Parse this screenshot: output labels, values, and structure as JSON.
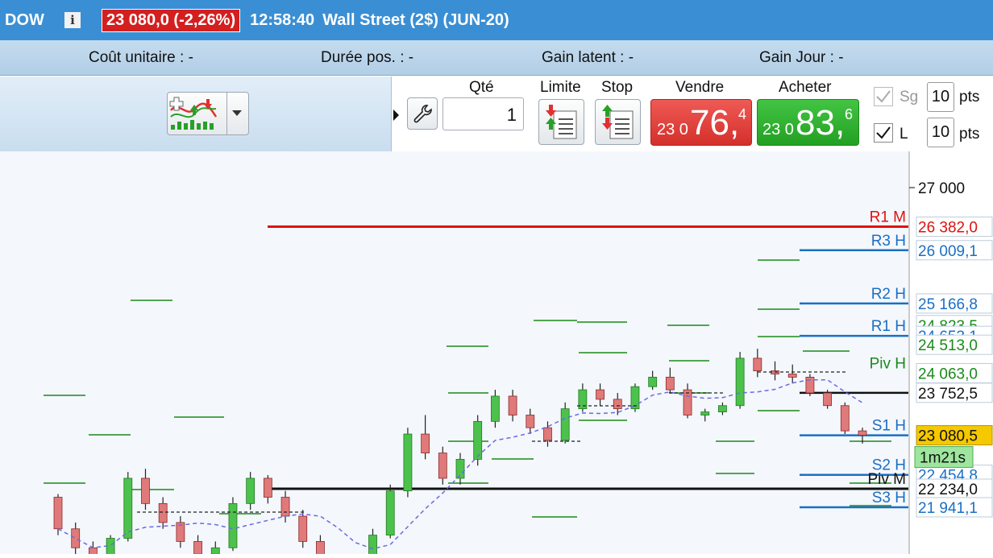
{
  "header": {
    "symbol": "DOW",
    "info_icon": "info-icon",
    "price_change": "23 080,0 (-2,26%)",
    "time": "12:58:40",
    "instrument": "Wall Street (2$) (JUN-20)",
    "accent": "#3a8fd4",
    "down_color": "#d41f1f"
  },
  "stats": {
    "unit_cost_label": "Coût unitaire :",
    "unit_cost_value": "-",
    "duration_label": "Durée pos. :",
    "duration_value": "-",
    "latent_gain_label": "Gain latent :",
    "latent_gain_value": "-",
    "day_gain_label": "Gain Jour :",
    "day_gain_value": "-"
  },
  "order": {
    "qty_label": "Qté",
    "qty_value": "1",
    "limit_label": "Limite",
    "stop_label": "Stop",
    "sell_label": "Vendre",
    "sell_prefix": "23 0",
    "sell_big": "76,",
    "sell_sup": "4",
    "buy_label": "Acheter",
    "buy_prefix": "23 0",
    "buy_big": "83,",
    "buy_sup": "6",
    "sg_label": "Sg",
    "sg_value": "10",
    "sg_unit": "pts",
    "l_label": "L",
    "l_value": "10",
    "l_unit": "pts"
  },
  "chart_data": {
    "type": "candlestick",
    "price_axis_ticks": [
      "27 000"
    ],
    "current_price": "23 080,5",
    "countdown": "1m21s",
    "levels": [
      {
        "label": "R1 M",
        "value": "26 382,0",
        "color": "#e01010"
      },
      {
        "label": "R3 H",
        "value": "26 009,1",
        "color": "#1a6fc4"
      },
      {
        "label": "R2 H",
        "value": "25 166,8",
        "color": "#1a6fc4"
      },
      {
        "label": "",
        "value": "24 823,5",
        "color": "#1a8a1a"
      },
      {
        "label": "R1 H",
        "value": "24 653,1",
        "color": "#1a6fc4"
      },
      {
        "label": "",
        "value": "24 513,0",
        "color": "#1a8a1a"
      },
      {
        "label": "Piv H",
        "value": "24 063,0",
        "color": "#1a8a1a"
      },
      {
        "label": "",
        "value": "23 752,5",
        "color": "#111111"
      },
      {
        "label": "S1 H",
        "value": "23 080,5",
        "color": "#1a6fc4"
      },
      {
        "label": "S2 H",
        "value": "22 454,8",
        "color": "#1a6fc4"
      },
      {
        "label": "Piv M",
        "value": "22 234,0",
        "color": "#111111"
      },
      {
        "label": "S3 H",
        "value": "21 941,1",
        "color": "#1a6fc4"
      }
    ],
    "candles": [
      [
        22100,
        22150,
        21500,
        21600
      ],
      [
        21600,
        21700,
        21200,
        21300
      ],
      [
        21300,
        21400,
        20900,
        21000
      ],
      [
        21000,
        21500,
        20950,
        21450
      ],
      [
        21450,
        22500,
        21400,
        22400
      ],
      [
        22400,
        22550,
        21900,
        22000
      ],
      [
        22000,
        22100,
        21600,
        21700
      ],
      [
        21700,
        21800,
        21300,
        21400
      ],
      [
        21400,
        21500,
        21100,
        21200
      ],
      [
        21200,
        21400,
        21000,
        21300
      ],
      [
        21300,
        22100,
        21250,
        22000
      ],
      [
        22000,
        22500,
        21900,
        22400
      ],
      [
        22400,
        22450,
        22000,
        22100
      ],
      [
        22100,
        22200,
        21700,
        21800
      ],
      [
        21800,
        21900,
        21300,
        21400
      ],
      [
        21400,
        21500,
        21000,
        21100
      ],
      [
        21100,
        21200,
        20800,
        20900
      ],
      [
        20900,
        21100,
        20700,
        21000
      ],
      [
        21000,
        21600,
        20950,
        21500
      ],
      [
        21500,
        22300,
        21450,
        22200
      ],
      [
        22200,
        23200,
        22100,
        23100
      ],
      [
        23100,
        23400,
        22700,
        22800
      ],
      [
        22800,
        22900,
        22300,
        22400
      ],
      [
        22400,
        22800,
        22300,
        22700
      ],
      [
        22700,
        23400,
        22600,
        23300
      ],
      [
        23300,
        23800,
        23200,
        23700
      ],
      [
        23700,
        23800,
        23300,
        23400
      ],
      [
        23400,
        23500,
        23100,
        23200
      ],
      [
        23200,
        23300,
        22900,
        23000
      ],
      [
        23000,
        23600,
        22950,
        23500
      ],
      [
        23500,
        23900,
        23450,
        23800
      ],
      [
        23800,
        23900,
        23550,
        23650
      ],
      [
        23650,
        23750,
        23400,
        23500
      ],
      [
        23500,
        23900,
        23450,
        23850
      ],
      [
        23850,
        24100,
        23800,
        24000
      ],
      [
        24000,
        24150,
        23750,
        23800
      ],
      [
        23800,
        23900,
        23350,
        23400
      ],
      [
        23400,
        23500,
        23300,
        23450
      ],
      [
        23450,
        23600,
        23400,
        23550
      ],
      [
        23550,
        24400,
        23500,
        24300
      ],
      [
        24300,
        24450,
        24000,
        24100
      ],
      [
        24100,
        24250,
        23950,
        24050
      ],
      [
        24050,
        24200,
        23900,
        24000
      ],
      [
        24000,
        24050,
        23700,
        23750
      ],
      [
        23750,
        23800,
        23500,
        23550
      ],
      [
        23550,
        23600,
        23100,
        23150
      ],
      [
        23150,
        23200,
        22950,
        23080
      ]
    ]
  }
}
